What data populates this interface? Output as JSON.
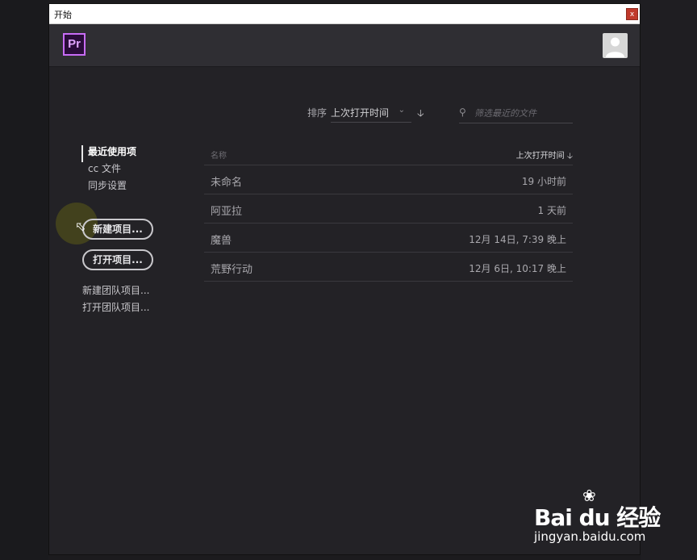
{
  "window": {
    "title": "开始",
    "close_label": "x"
  },
  "app": {
    "logo_text": "Pr"
  },
  "toolbar": {
    "sort_label": "排序",
    "sort_value": "上次打开时间",
    "filter_placeholder": "筛选最近的文件"
  },
  "nav": {
    "items": [
      {
        "label": "最近使用项"
      },
      {
        "label": "cc 文件"
      },
      {
        "label": "同步设置"
      }
    ],
    "new_project": "新建项目...",
    "open_project": "打开项目...",
    "new_team_project": "新建团队项目...",
    "open_team_project": "打开团队项目..."
  },
  "table": {
    "col_name": "名称",
    "col_time": "上次打开时间",
    "rows": [
      {
        "name": "未命名",
        "time": "19 小时前"
      },
      {
        "name": "阿亚拉",
        "time": "1 天前"
      },
      {
        "name": "魔兽",
        "time": "12月 14日, 7:39 晚上"
      },
      {
        "name": "荒野行动",
        "time": "12月 6日, 10:17 晚上"
      }
    ]
  },
  "watermark": {
    "logo": "Bai du 经验",
    "url": "jingyan.baidu.com"
  }
}
